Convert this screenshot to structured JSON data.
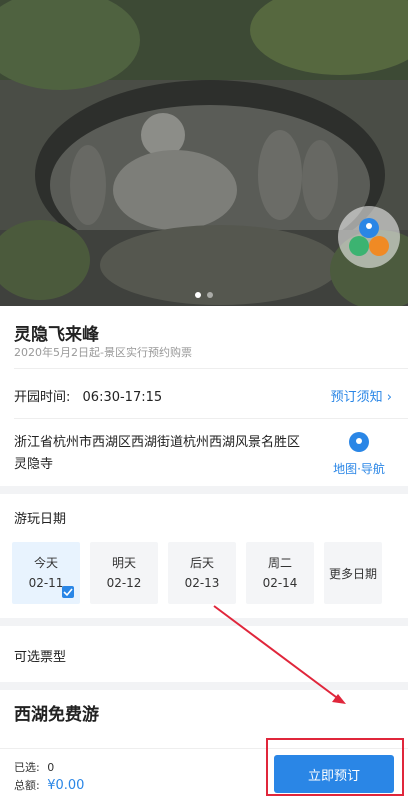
{
  "hero": {
    "dots": 2,
    "active_dot": 0
  },
  "info": {
    "title": "灵隐飞来峰",
    "subtitle": "2020年5月2日起-景区实行预约购票",
    "hours_label": "开园时间:",
    "hours_value": "06:30-17:15",
    "notice_label": "预订须知",
    "address": "浙江省杭州市西湖区西湖街道杭州西湖风景名胜区灵隐寺",
    "map_nav_label": "地图·导航"
  },
  "dates": {
    "title": "游玩日期",
    "items": [
      {
        "day": "今天",
        "date": "02-11",
        "selected": true
      },
      {
        "day": "明天",
        "date": "02-12",
        "selected": false
      },
      {
        "day": "后天",
        "date": "02-13",
        "selected": false
      },
      {
        "day": "周二",
        "date": "02-14",
        "selected": false
      }
    ],
    "more_label": "更多日期"
  },
  "tickets": {
    "title": "可选票型",
    "package_title": "西湖免费游"
  },
  "bottom": {
    "selected_label": "已选:",
    "selected_value": "0",
    "total_label": "总额:",
    "total_value": "¥0.00",
    "book_label": "立即预订"
  },
  "colors": {
    "accent": "#2a86e6",
    "annotation": "#e0263b"
  }
}
